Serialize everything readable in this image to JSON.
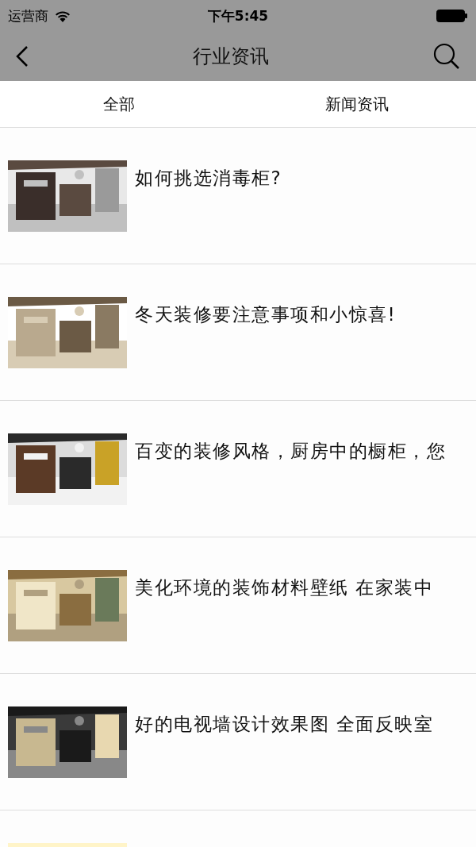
{
  "status_bar": {
    "carrier": "运营商",
    "time": "下午5:45"
  },
  "nav": {
    "title": "行业资讯"
  },
  "tabs": [
    {
      "label": "全部"
    },
    {
      "label": "新闻资讯"
    }
  ],
  "articles": [
    {
      "title": "如何挑选消毒柜?",
      "image": {
        "kind": "picture"
      }
    },
    {
      "title": "冬天装修要注意事项和小惊喜!",
      "image": {
        "kind": "picture"
      }
    },
    {
      "title": "百变的装修风格，厨房中的橱柜，您",
      "image": {
        "kind": "picture"
      }
    },
    {
      "title": "美化环境的装饰材料壁纸 在家装中",
      "image": {
        "kind": "picture"
      }
    },
    {
      "title": "好的电视墙设计效果图 全面反映室",
      "image": {
        "kind": "picture"
      }
    },
    {
      "image": {
        "kind": "picture"
      }
    }
  ]
}
